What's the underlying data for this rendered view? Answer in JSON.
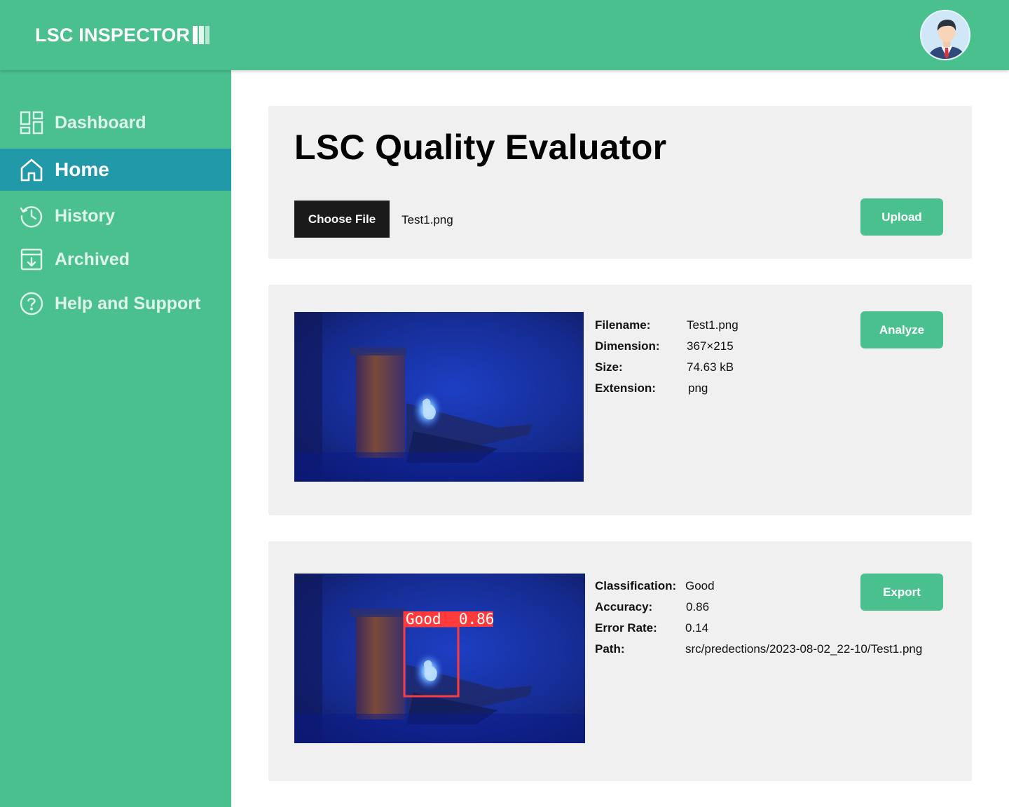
{
  "header": {
    "logo_text": "LSC INSPECTOR",
    "avatar_icon": "user-avatar-icon"
  },
  "sidebar": {
    "items": [
      {
        "label": "Dashboard",
        "icon": "dashboard-icon",
        "active": false
      },
      {
        "label": "Home",
        "icon": "home-icon",
        "active": true
      },
      {
        "label": "History",
        "icon": "history-icon",
        "active": false
      },
      {
        "label": "Archived",
        "icon": "archive-icon",
        "active": false
      },
      {
        "label": "Help and Support",
        "icon": "help-icon",
        "active": false
      }
    ]
  },
  "upload_card": {
    "title": "LSC Quality Evaluator",
    "choose_file_label": "Choose File",
    "selected_file": "Test1.png",
    "upload_label": "Upload"
  },
  "preview_card": {
    "analyze_label": "Analyze",
    "fields": [
      {
        "label": "Filename:",
        "value": "Test1.png"
      },
      {
        "label": "Dimension:",
        "value": "367×215"
      },
      {
        "label": "Size:",
        "value": "74.63 kB"
      },
      {
        "label": "Extension:",
        "value": "png"
      }
    ]
  },
  "result_card": {
    "export_label": "Export",
    "detection_label": "Good  0.86",
    "fields": [
      {
        "label": "Classification:",
        "value": "Good"
      },
      {
        "label": "Accuracy:",
        "value": "0.86"
      },
      {
        "label": "Error Rate:",
        "value": "0.14"
      },
      {
        "label": "Path:",
        "value": "src/predections/2023-08-02_22-10/Test1.png"
      }
    ]
  },
  "colors": {
    "brand_green": "#4bc08f",
    "active_nav": "#2299a9",
    "card_bg": "#f0f0f0",
    "detection_box": "#ff3b3b"
  }
}
